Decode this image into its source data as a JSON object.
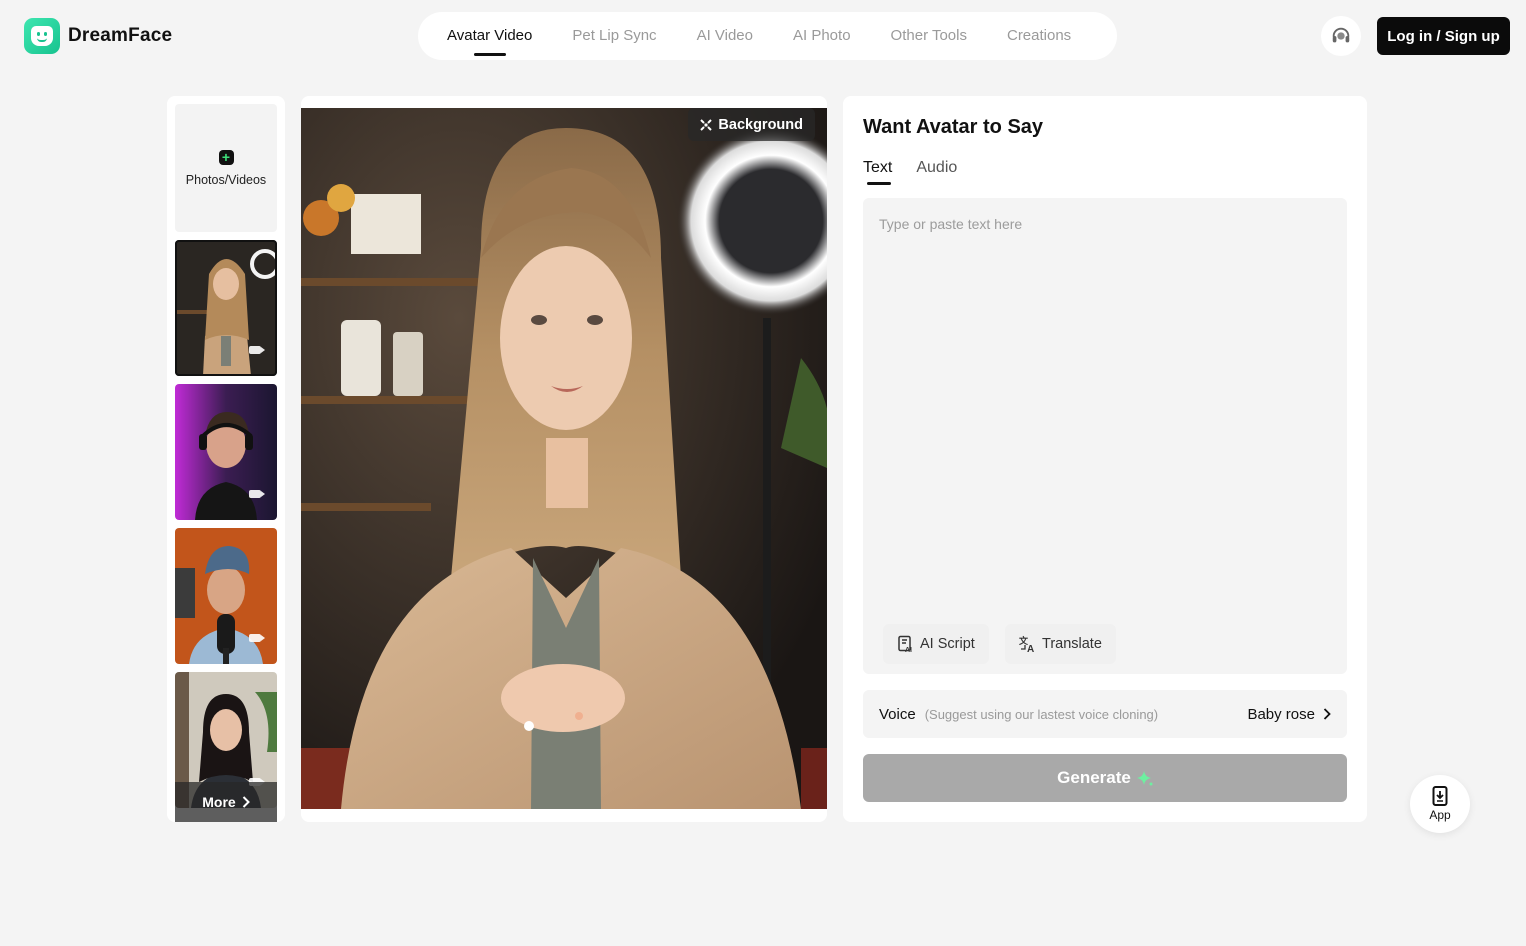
{
  "brand": {
    "name": "DreamFace"
  },
  "nav": {
    "items": [
      {
        "label": "Avatar Video",
        "active": true
      },
      {
        "label": "Pet Lip Sync",
        "active": false
      },
      {
        "label": "AI Video",
        "active": false
      },
      {
        "label": "AI Photo",
        "active": false
      },
      {
        "label": "Other Tools",
        "active": false
      },
      {
        "label": "Creations",
        "active": false
      }
    ]
  },
  "header": {
    "login_label": "Log in / Sign up"
  },
  "sidebar": {
    "upload_label": "Photos/Videos",
    "more_label": "More"
  },
  "preview": {
    "background_label": "Background"
  },
  "panel": {
    "title": "Want Avatar to Say",
    "tabs": [
      {
        "label": "Text",
        "active": true
      },
      {
        "label": "Audio",
        "active": false
      }
    ],
    "text_placeholder": "Type or paste text here",
    "ai_script_label": "AI Script",
    "translate_label": "Translate",
    "voice_label": "Voice",
    "voice_hint": "(Suggest using our lastest voice cloning)",
    "voice_value": "Baby rose",
    "generate_label": "Generate"
  },
  "floating": {
    "app_label": "App"
  },
  "colors": {
    "brand": "#17c38f",
    "sparkle": "#6df0a0",
    "generate_disabled": "#a9a9a9"
  }
}
